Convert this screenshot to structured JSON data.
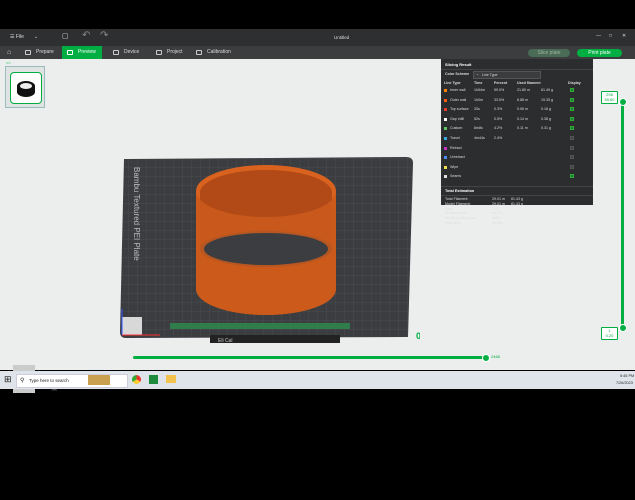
{
  "titlebar": {
    "file_label": "File",
    "document_title": "Untitled"
  },
  "tabs": [
    {
      "label": "Prepare"
    },
    {
      "label": "Preview"
    },
    {
      "label": "Device"
    },
    {
      "label": "Project"
    },
    {
      "label": "Calibration"
    }
  ],
  "active_tab": "Preview",
  "actions": {
    "slice_label": "Slice plate",
    "print_label": "Print plate"
  },
  "viewport": {
    "bed_brand_text": "Bambu Textured PEI Plate",
    "plate_number": "01",
    "plate_label": "Eli Cal"
  },
  "panel": {
    "title": "Slicing Result",
    "color_scheme_label": "Color Scheme",
    "color_scheme_value": "Line Type",
    "headers": [
      "Line Type",
      "Time",
      "Percent",
      "Used filament",
      "Display"
    ],
    "rows": [
      {
        "name": "Inner wall",
        "color": "#ff8000",
        "time": "1h54m",
        "percent": "59.0%",
        "length": "21.80 m",
        "weight": "61.49 g",
        "display": true
      },
      {
        "name": "Outer wall",
        "color": "#ff5a14",
        "time": "1h0m",
        "percent": "33.5%",
        "length": "6.88 m",
        "weight": "19.35 g",
        "display": true
      },
      {
        "name": "Top surface",
        "color": "#e63c30",
        "time": "33s",
        "percent": "0.3%",
        "length": "0.06 m",
        "weight": "0.18 g",
        "display": true
      },
      {
        "name": "Gap infill",
        "color": "#ffffff",
        "time": "52s",
        "percent": "0.5%",
        "length": "0.14 m",
        "weight": "0.38 g",
        "display": true
      },
      {
        "name": "Custom",
        "color": "#5ec45e",
        "time": "8m8s",
        "percent": "4.2%",
        "length": "0.11 m",
        "weight": "0.31 g",
        "display": true
      },
      {
        "name": "Travel",
        "color": "#38a8e8",
        "time": "4m44s",
        "percent": "2.4%",
        "length": "",
        "weight": "",
        "display": false
      },
      {
        "name": "Retract",
        "color": "#c832c8",
        "time": "",
        "percent": "",
        "length": "",
        "weight": "",
        "display": false
      },
      {
        "name": "Unretract",
        "color": "#4e8cf4",
        "time": "",
        "percent": "",
        "length": "",
        "weight": "",
        "display": false
      },
      {
        "name": "Wipe",
        "color": "#f0e050",
        "time": "",
        "percent": "",
        "length": "",
        "weight": "",
        "display": false
      },
      {
        "name": "Seams",
        "color": "#e0e0e0",
        "time": "",
        "percent": "",
        "length": "",
        "weight": "",
        "display": true
      }
    ],
    "estimation_title": "Total Estimation",
    "estimation": [
      {
        "label": "Total Filament:",
        "v1": "29.01 m",
        "v2": "81.43 g"
      },
      {
        "label": "Model Filament:",
        "v1": "29.01 m",
        "v2": "81.43 g"
      },
      {
        "label": "Cost:",
        "v1": "1.63",
        "v2": ""
      },
      {
        "label": "Prepare time:",
        "v1": "8m27s",
        "v2": ""
      },
      {
        "label": "Model printing time:",
        "v1": "3h6m",
        "v2": ""
      },
      {
        "label": "Total time:",
        "v1": "3h14m",
        "v2": ""
      }
    ]
  },
  "layer_slider": {
    "top_layer": "296",
    "top_height": "59.60",
    "bottom_layer": "1",
    "bottom_height": "0.20"
  },
  "move_slider": {
    "value": "2468"
  },
  "view_cube": {
    "top": "Top",
    "front": "Front"
  },
  "taskbar": {
    "search_placeholder": "Type here to search",
    "time": "5:45 PM",
    "date": "7/26/2023"
  }
}
